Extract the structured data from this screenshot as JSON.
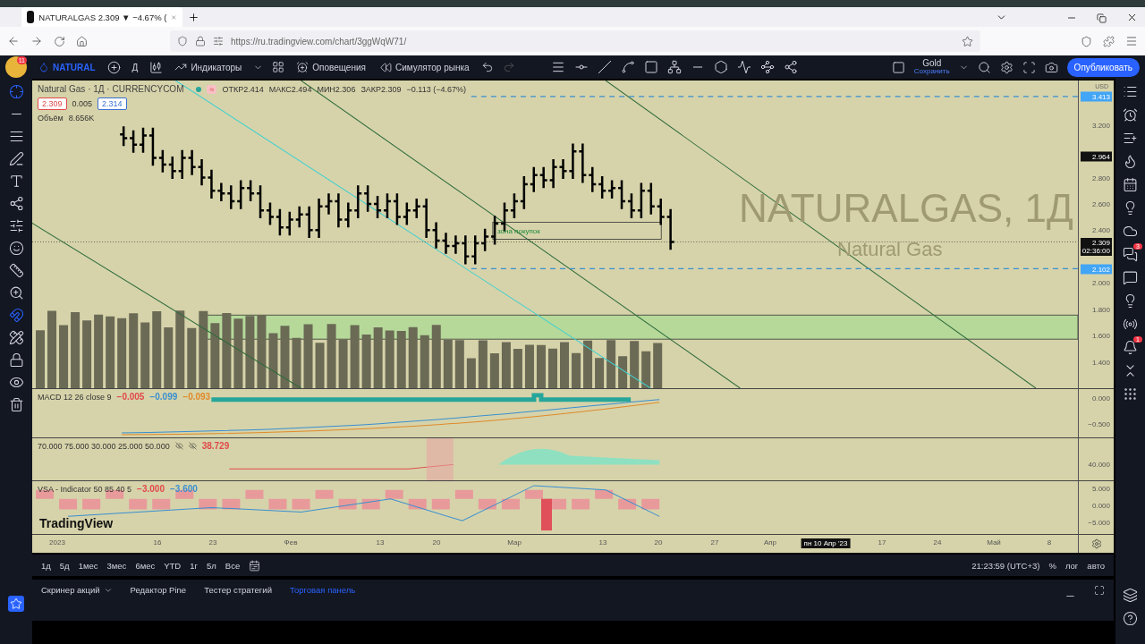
{
  "browser": {
    "tab": {
      "title": "NATURALGAS 2.309 ▼ −4.67% (",
      "selected": true
    },
    "url": "https://ru.tradingview.com/chart/3ggWqW71/"
  },
  "toolbar": {
    "notifications": "11",
    "symbol": "NATURAL",
    "interval": "Д",
    "indicators": "Индикаторы",
    "alerts": "Оповещения",
    "replay": "Симулятор рынка",
    "layout": {
      "name": "Gold",
      "status": "Сохранить"
    },
    "publish": "Опубликовать"
  },
  "legend": {
    "title": "Natural Gas · 1Д · CURRENCYCOM",
    "status_glyph": "≈",
    "ohlc": [
      {
        "label": "ОТКР",
        "value": "2.414"
      },
      {
        "label": "МАКС",
        "value": "2.494"
      },
      {
        "label": "МИН",
        "value": "2.306"
      },
      {
        "label": "ЗАКР",
        "value": "2.309"
      }
    ],
    "change": "−0.113 (−4.67%)",
    "bid": "2.309",
    "spread": "0.005",
    "ask": "2.314",
    "volume": {
      "label": "Объём",
      "value": "8.656K"
    }
  },
  "chart": {
    "watermark": {
      "symbol": "NATURALGAS, 1Д",
      "name": "Natural Gas"
    },
    "zone_label": "зона покупок",
    "logo": "TradingView",
    "currency": "USD",
    "price_ticks": [
      "3.200",
      "2.800",
      "2.600",
      "2.400",
      "2.000",
      "1.800",
      "1.600",
      "1.400"
    ],
    "price_labels": [
      {
        "kind": "line",
        "text": "3.413"
      },
      {
        "kind": "crosshair",
        "text": "2.964"
      },
      {
        "kind": "last",
        "text": "2.309",
        "countdown": "02:36:00"
      },
      {
        "kind": "line",
        "text": "2.102"
      }
    ]
  },
  "indicators": [
    {
      "kind": "macd",
      "title": "MACD 12 26 close 9",
      "values": [
        {
          "text": "−0.005",
          "color": "#e04a4a"
        },
        {
          "text": "−0.099",
          "color": "#3a8fd0"
        },
        {
          "text": "−0.093",
          "color": "#e08a2a"
        }
      ],
      "ticks": [
        "0.000",
        "−0.500"
      ]
    },
    {
      "kind": "oscillator",
      "params": "70.000 75.000 30.000 25.000 50.000",
      "values": [
        {
          "text": "38.729",
          "color": "#e04a4a"
        }
      ],
      "ticks": [
        "40.000"
      ]
    },
    {
      "kind": "vsa",
      "title": "VSA - Indicator 50 85 40 5",
      "values": [
        {
          "text": "−3.000",
          "color": "#e04a4a"
        },
        {
          "text": "−3.600",
          "color": "#3a8fd0"
        }
      ],
      "ticks": [
        "5.000",
        "0.000",
        "−5.000"
      ]
    }
  ],
  "time_axis": [
    {
      "text": "2023",
      "crosshair": false
    },
    {
      "text": "16",
      "crosshair": false
    },
    {
      "text": "23",
      "crosshair": false
    },
    {
      "text": "Фев",
      "crosshair": false
    },
    {
      "text": "13",
      "crosshair": false
    },
    {
      "text": "20",
      "crosshair": false
    },
    {
      "text": "Мар",
      "crosshair": false
    },
    {
      "text": "13",
      "crosshair": false
    },
    {
      "text": "20",
      "crosshair": false
    },
    {
      "text": "27",
      "crosshair": false
    },
    {
      "text": "Апр",
      "crosshair": false
    },
    {
      "text": "пн 10 Апр '23",
      "crosshair": true
    },
    {
      "text": "17",
      "crosshair": false
    },
    {
      "text": "24",
      "crosshair": false
    },
    {
      "text": "Май",
      "crosshair": false
    },
    {
      "text": "8",
      "crosshair": false
    }
  ],
  "ranges": [
    "1д",
    "5д",
    "1мес",
    "3мес",
    "6мес",
    "YTD",
    "1г",
    "5л",
    "Все"
  ],
  "clock": "21:23:59 (UTC+3)",
  "scale_options": [
    "%",
    "лог",
    "авто"
  ],
  "bottom_tabs": [
    {
      "label": "Скринер акций",
      "has_menu": true,
      "selected": false
    },
    {
      "label": "Редактор Pine",
      "has_menu": false,
      "selected": false
    },
    {
      "label": "Тестер стратегий",
      "has_menu": false,
      "selected": false
    },
    {
      "label": "Торговая панель",
      "has_menu": false,
      "selected": true
    }
  ],
  "sidebar": {
    "chat_badge": "3",
    "alerts_badge": "1"
  }
}
